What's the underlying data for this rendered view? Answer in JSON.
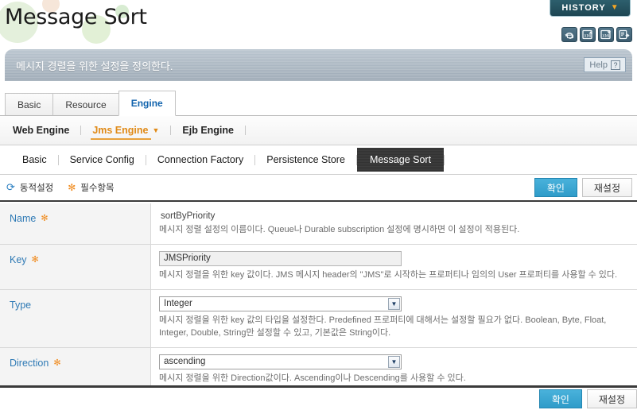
{
  "header": {
    "title": "Message Sort",
    "history_button": {
      "label": "HISTORY",
      "caret_icon": "chevron-down-icon"
    },
    "tool_icons": [
      {
        "name": "refresh-icon",
        "title": "Refresh"
      },
      {
        "name": "xml-import-icon",
        "title": "XML Import",
        "text": "XML"
      },
      {
        "name": "xml-export-icon",
        "title": "XML Export",
        "text": "XML"
      },
      {
        "name": "export-file-icon",
        "title": "Export"
      }
    ]
  },
  "banner": {
    "description": "메시지 경렬을 위한 설정을 정의한다.",
    "help": {
      "label": "Help",
      "icon_glyph": "?"
    }
  },
  "tabs_level1": [
    {
      "label": "Basic",
      "active": false
    },
    {
      "label": "Resource",
      "active": false
    },
    {
      "label": "Engine",
      "active": true
    }
  ],
  "nav_level2": [
    {
      "label": "Web Engine",
      "active": false,
      "has_dropdown": false
    },
    {
      "label": "Jms Engine",
      "active": true,
      "has_dropdown": true
    },
    {
      "label": "Ejb Engine",
      "active": false,
      "has_dropdown": false
    }
  ],
  "tabs_level3": [
    {
      "label": "Basic",
      "active": false
    },
    {
      "label": "Service Config",
      "active": false
    },
    {
      "label": "Connection Factory",
      "active": false
    },
    {
      "label": "Persistence Store",
      "active": false
    },
    {
      "label": "Message Sort",
      "active": true
    }
  ],
  "action_bar": {
    "legend": [
      {
        "label": "동적설정",
        "icon": "dynamic-config-icon",
        "glyph": "⟳",
        "color": "#2a7fc1"
      },
      {
        "label": "필수항목",
        "icon": "required-field-icon",
        "glyph": "✻",
        "color": "#f08b1e"
      }
    ],
    "confirm_label": "확인",
    "reset_label": "재설정"
  },
  "form_rows": [
    {
      "label": "Name",
      "required": true,
      "field_type": "text",
      "value": "sortByPriority",
      "description": "메시지 정렬 설정의 이름이다. Queue나 Durable subscription 설정에 명시하면 이 설정이 적용된다."
    },
    {
      "label": "Key",
      "required": true,
      "field_type": "input",
      "value": "JMSPriority",
      "placeholder": "",
      "description": "메시지 정렬을 위한 key 값이다. JMS 메시지 header의 \"JMS\"로 시작하는 프로퍼티나 임의의 User 프로퍼티를 사용할 수 있다."
    },
    {
      "label": "Type",
      "required": false,
      "field_type": "select",
      "value": "Integer",
      "options": [
        "Boolean",
        "Byte",
        "Float",
        "Integer",
        "Double",
        "String"
      ],
      "description": "메시지 정렬을 위한 key 값의 타입을 설정한다. Predefined 프로퍼티에 대해서는 설정할 필요가 없다. Boolean, Byte, Float, Integer, Double, String만 설정할 수 있고, 기본값은 String이다."
    },
    {
      "label": "Direction",
      "required": true,
      "field_type": "select",
      "value": "ascending",
      "options": [
        "ascending",
        "descending"
      ],
      "description": "메시지 정렬을 위한 Direction값이다. Ascending이나 Descending를 사용할 수 있다."
    }
  ],
  "footer": {
    "confirm_label": "확인",
    "reset_label": "재설정"
  },
  "colors": {
    "accent_blue": "#2f9cc9",
    "label_blue": "#2f7ab5",
    "required_orange": "#f08b1e",
    "active_nav_orange": "#e08a17",
    "active_tab_dark": "#333333",
    "banner_gray": "#aab6c1"
  }
}
